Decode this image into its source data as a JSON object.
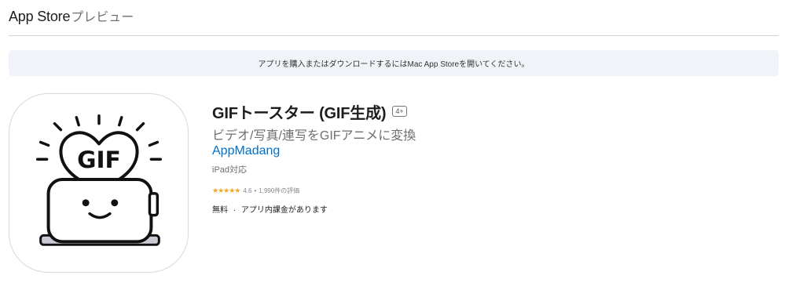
{
  "header": {
    "brand": "App Store",
    "subtitle": "プレビュー"
  },
  "banner": {
    "text": "アプリを購入またはダウンロードするにはMac App Storeを開いてください。"
  },
  "app": {
    "name": "GIFトースター (GIF生成)",
    "age_rating": "4+",
    "subtitle": "ビデオ/写真/連写をGIFアニメに変換",
    "developer": "AppMadang",
    "compatibility": "iPad対応",
    "stars": "★★★★★",
    "rating": "4.6",
    "rating_count": "1,990件の評価",
    "rating_separator": "•",
    "price": "無料",
    "price_separator": "·",
    "in_app": "アプリ内課金があります",
    "icon_text": "GIF"
  },
  "colors": {
    "link": "#0070c9",
    "star": "#f5a623",
    "banner_bg": "#f0f4f8"
  }
}
